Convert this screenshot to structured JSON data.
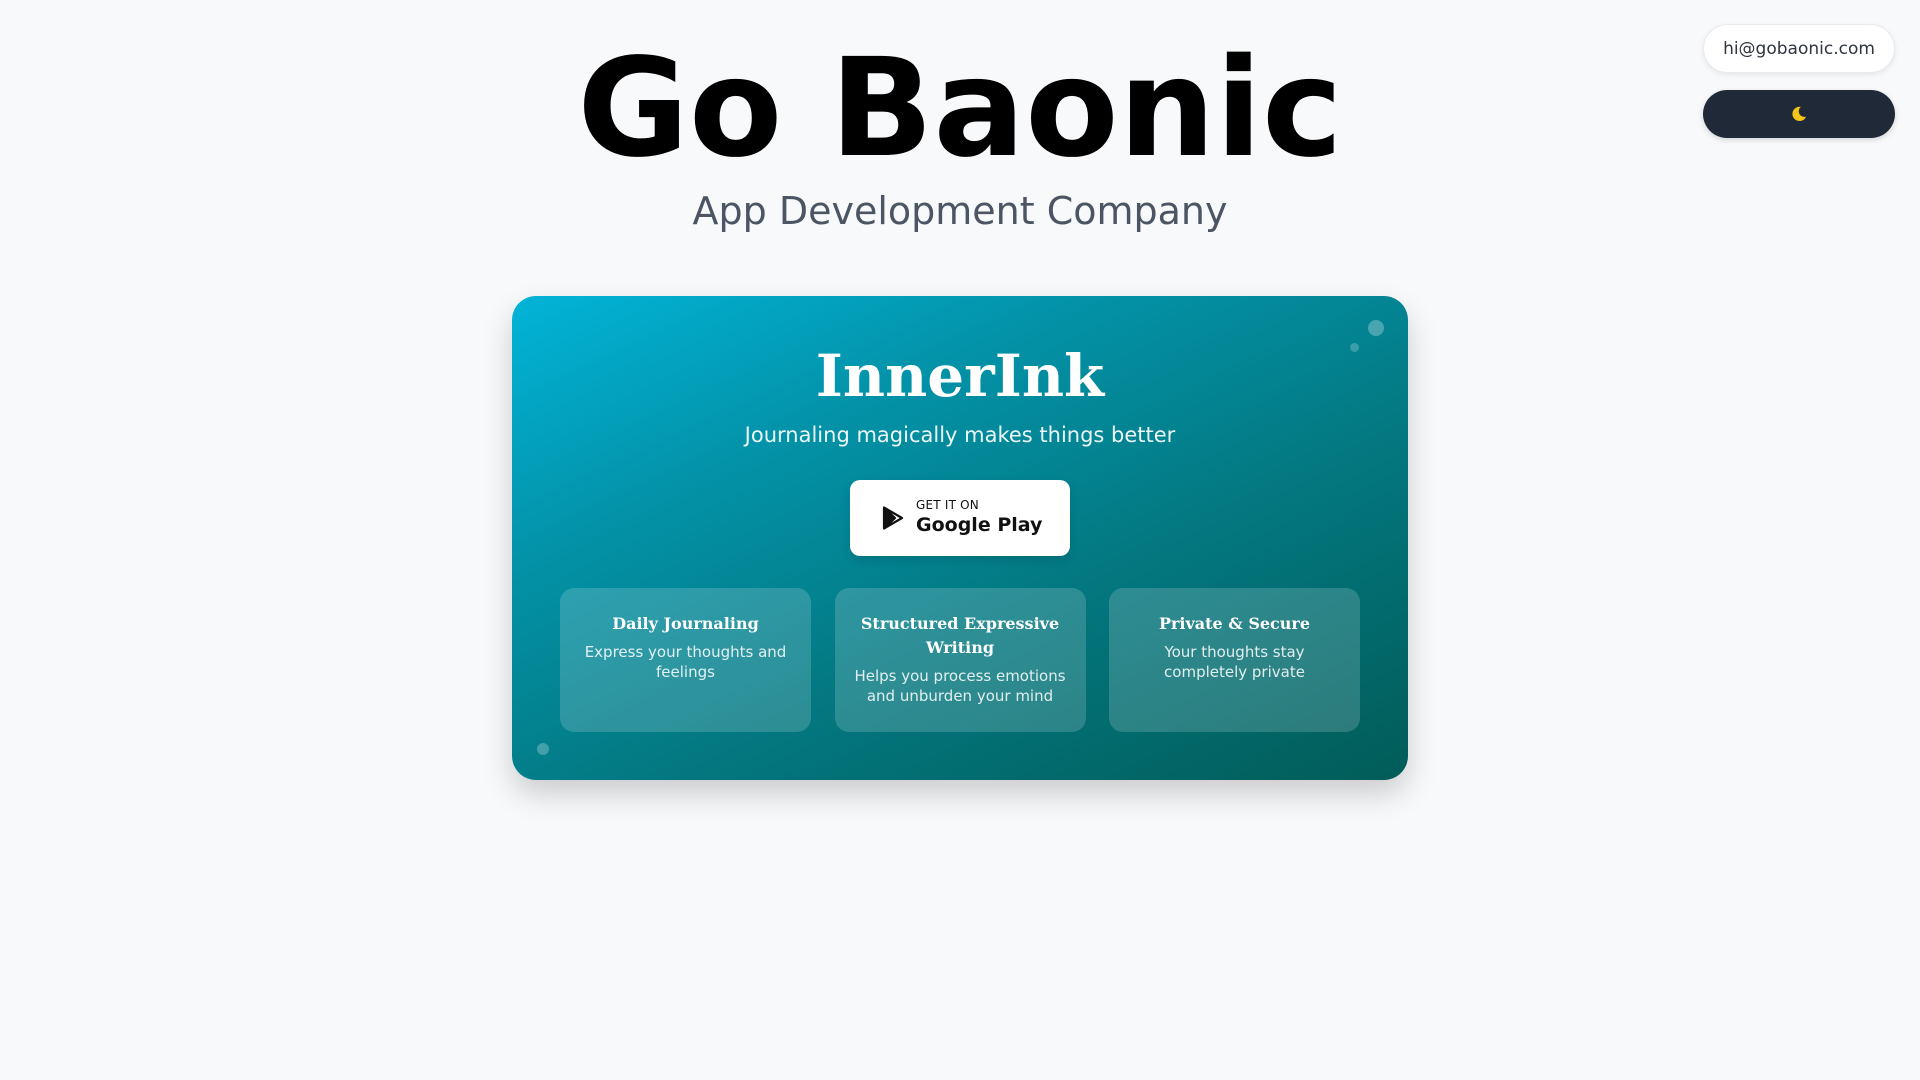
{
  "header": {
    "title": "Go Baonic",
    "subtitle": "App Development Company"
  },
  "top_controls": {
    "email": "hi@gobaonic.com",
    "theme_toggle_icon": "moon-icon",
    "theme_toggle_color": "#1f2937",
    "moon_color": "#f5c518"
  },
  "app_card": {
    "title": "InnerInk",
    "tagline": "Journaling magically makes things better",
    "gradient_start": "#02b4d8",
    "gradient_end": "#015c58",
    "store_button": {
      "icon": "google-play-icon",
      "small_label": "GET IT ON",
      "big_label": "Google Play"
    },
    "features": [
      {
        "title": "Daily Journaling",
        "description": "Express your thoughts and feelings"
      },
      {
        "title": "Structured Expressive Writing",
        "description": "Helps you process emotions and unburden your mind"
      },
      {
        "title": "Private & Secure",
        "description": "Your thoughts stay completely private"
      }
    ]
  }
}
